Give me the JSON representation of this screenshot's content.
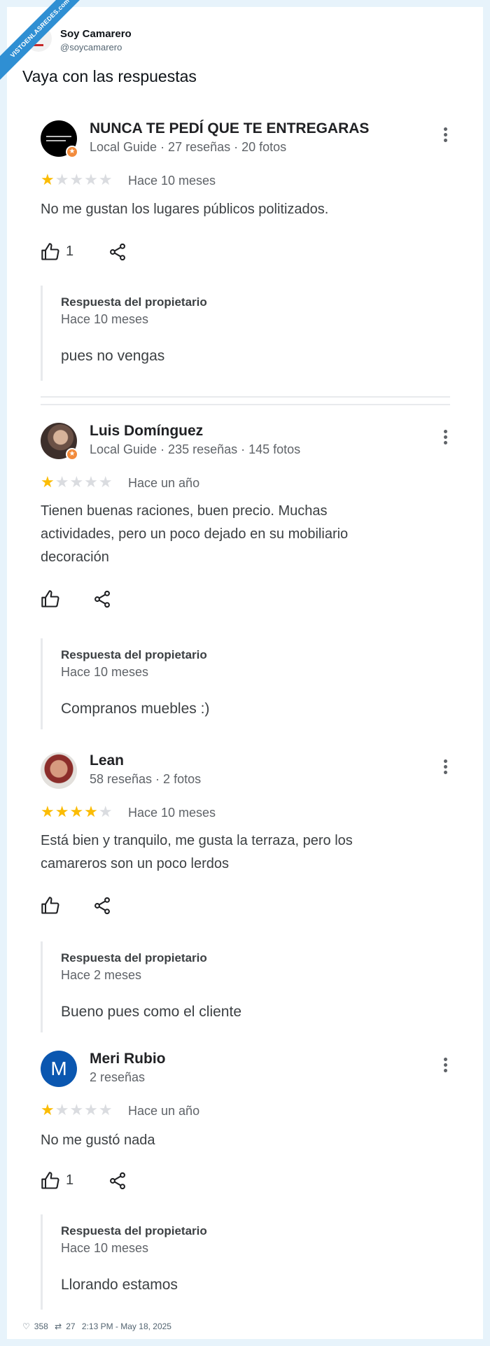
{
  "watermark": "VISTOENLASREDES.com",
  "tweet": {
    "author_name": "Soy Camarero",
    "author_handle": "@soycamarero",
    "text": "Vaya con las respuestas",
    "likes": "358",
    "retweets": "27",
    "timestamp": "2:13 PM - May 18, 2025"
  },
  "reviews": [
    {
      "name": "NUNCA TE PEDÍ QUE TE ENTREGARAS",
      "meta": "Local Guide · 27 reseñas · 20 fotos",
      "rating": 1,
      "date": "Hace 10 meses",
      "text": "No me gustan los lugares públicos politizados.",
      "likes": "1",
      "owner_reply": {
        "title": "Respuesta del propietario",
        "date": "Hace 10 meses",
        "text": "pues no vengas"
      }
    },
    {
      "name": "Luis Domínguez",
      "meta": "Local Guide · 235 reseñas · 145 fotos",
      "rating": 1,
      "date": "Hace un año",
      "text": "Tienen buenas raciones, buen precio. Muchas actividades, pero un poco dejado en su mobiliario decoración",
      "likes": "",
      "owner_reply": {
        "title": "Respuesta del propietario",
        "date": "Hace 10 meses",
        "text": "Compranos muebles :)"
      }
    },
    {
      "name": "Lean",
      "meta": "58 reseñas · 2 fotos",
      "rating": 4,
      "date": "Hace 10 meses",
      "text": "Está bien y tranquilo, me gusta la terraza, pero los camareros son un poco lerdos",
      "likes": "",
      "owner_reply": {
        "title": "Respuesta del propietario",
        "date": "Hace 2 meses",
        "text": "Bueno pues como el cliente"
      }
    },
    {
      "name": "Meri Rubio",
      "avatar_letter": "M",
      "meta": "2 reseñas",
      "rating": 1,
      "date": "Hace un año",
      "text": "No me gustó nada",
      "likes": "1",
      "owner_reply": {
        "title": "Respuesta del propietario",
        "date": "Hace 10 meses",
        "text": "Llorando estamos"
      }
    }
  ],
  "colors": {
    "star": "#fbbc04",
    "star_empty": "#dadce0",
    "accent_blue": "#0b57b0",
    "guide_badge": "#f28b3c"
  }
}
